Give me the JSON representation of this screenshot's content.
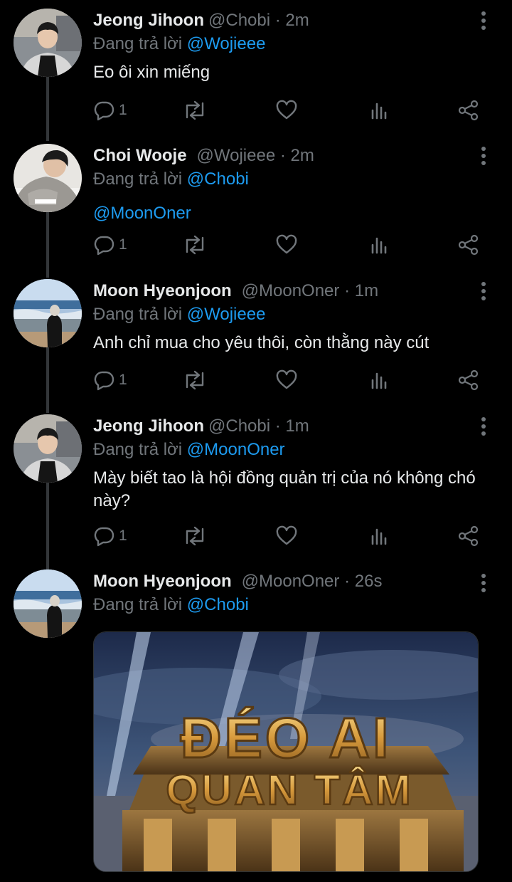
{
  "tweets": [
    {
      "name": "Jeong Jihoon",
      "handle": "@Chobi",
      "separator": "·",
      "time": "2m",
      "reply_prefix": "Đang trả lời",
      "reply_to": "@Wojieee",
      "text": "Eo ôi xin miếng",
      "text_mention": "",
      "reply_count": "1"
    },
    {
      "name": "Choi Wooje",
      "handle": "@Wojieee",
      "separator": "·",
      "time": "2m",
      "reply_prefix": "Đang trả lời",
      "reply_to": "@Chobi",
      "text": "",
      "text_mention": "@MoonOner",
      "reply_count": "1"
    },
    {
      "name": "Moon Hyeonjoon",
      "handle": "@MoonOner",
      "separator": "·",
      "time": "1m",
      "reply_prefix": "Đang trả lời",
      "reply_to": "@Wojieee",
      "text": "Anh chỉ mua cho yêu thôi, còn thằng này cút",
      "text_mention": "",
      "reply_count": "1"
    },
    {
      "name": "Jeong Jihoon",
      "handle": "@Chobi",
      "separator": "·",
      "time": "1m",
      "reply_prefix": "Đang trả lời",
      "reply_to": "@MoonOner",
      "text": "Mày biết tao là hội đồng quản trị của nó không chó này?",
      "text_mention": "",
      "reply_count": "1"
    },
    {
      "name": "Moon Hyeonjoon",
      "handle": "@MoonOner",
      "separator": "·",
      "time": "26s",
      "reply_prefix": "Đang trả lời",
      "reply_to": "@Chobi",
      "text": "",
      "text_mention": "",
      "reply_count": ""
    }
  ],
  "media": {
    "line1": "ĐÉO AI",
    "line2": "QUAN TÂM"
  },
  "colors": {
    "background": "#000000",
    "text": "#e7e9ea",
    "muted": "#71767b",
    "mention": "#1d9bf0",
    "thread_line": "#333639"
  },
  "icons": [
    "reply-icon",
    "retweet-icon",
    "like-icon",
    "views-icon",
    "share-icon",
    "more-icon"
  ]
}
